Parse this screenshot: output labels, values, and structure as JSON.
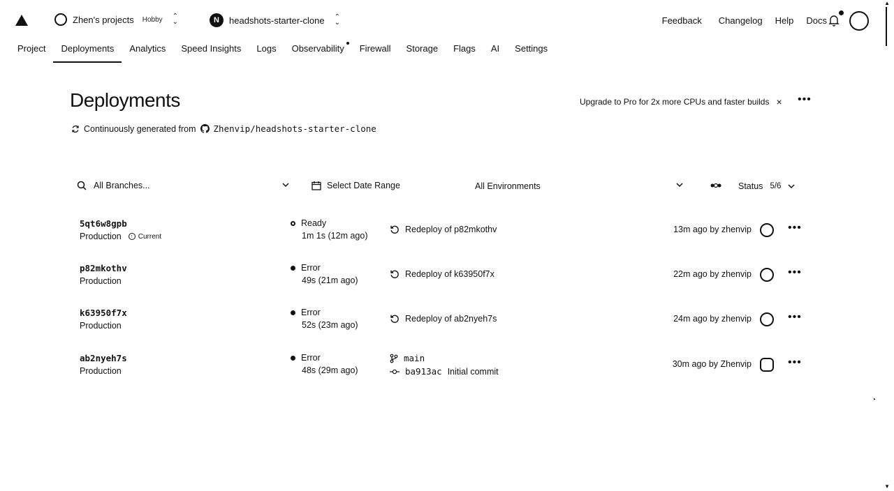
{
  "header": {
    "team_name": "Zhen's projects",
    "plan": "Hobby",
    "project_initial": "N",
    "project_name": "headshots-starter-clone",
    "links": [
      "Feedback",
      "Changelog",
      "Help",
      "Docs"
    ]
  },
  "tabs": [
    {
      "label": "Project",
      "active": false
    },
    {
      "label": "Deployments",
      "active": true
    },
    {
      "label": "Analytics",
      "active": false
    },
    {
      "label": "Speed Insights",
      "active": false
    },
    {
      "label": "Logs",
      "active": false
    },
    {
      "label": "Observability",
      "active": false,
      "dot": true
    },
    {
      "label": "Firewall",
      "active": false
    },
    {
      "label": "Storage",
      "active": false
    },
    {
      "label": "Flags",
      "active": false
    },
    {
      "label": "AI",
      "active": false
    },
    {
      "label": "Settings",
      "active": false
    }
  ],
  "page": {
    "title": "Deployments",
    "source_prefix": "Continuously generated from",
    "repo": "Zhenvip/headshots-starter-clone",
    "upgrade_text": "Upgrade to Pro for 2x more CPUs and faster builds",
    "close_glyph": "×",
    "more_glyph": "•••"
  },
  "filters": {
    "branches_placeholder": "All Branches...",
    "date_range": "Select Date Range",
    "environments": "All Environments",
    "status_label": "Status",
    "status_count": "5/6"
  },
  "deployments": [
    {
      "id": "5qt6w8gpb",
      "environment": "Production",
      "current_label": "Current",
      "status": "Ready",
      "duration": "1m 1s (12m ago)",
      "source": "Redeploy of p82mkothv",
      "time_by": "13m ago by zhenvip"
    },
    {
      "id": "p82mkothv",
      "environment": "Production",
      "status": "Error",
      "duration": "49s (21m ago)",
      "source": "Redeploy of k63950f7x",
      "time_by": "22m ago by zhenvip"
    },
    {
      "id": "k63950f7x",
      "environment": "Production",
      "status": "Error",
      "duration": "52s (23m ago)",
      "source": "Redeploy of ab2nyeh7s",
      "time_by": "24m ago by zhenvip"
    },
    {
      "id": "ab2nyeh7s",
      "environment": "Production",
      "status": "Error",
      "duration": "48s (29m ago)",
      "branch": "main",
      "commit_hash": "ba913ac",
      "commit_message": "Initial commit",
      "time_by": "30m ago by Zhenvip"
    }
  ]
}
